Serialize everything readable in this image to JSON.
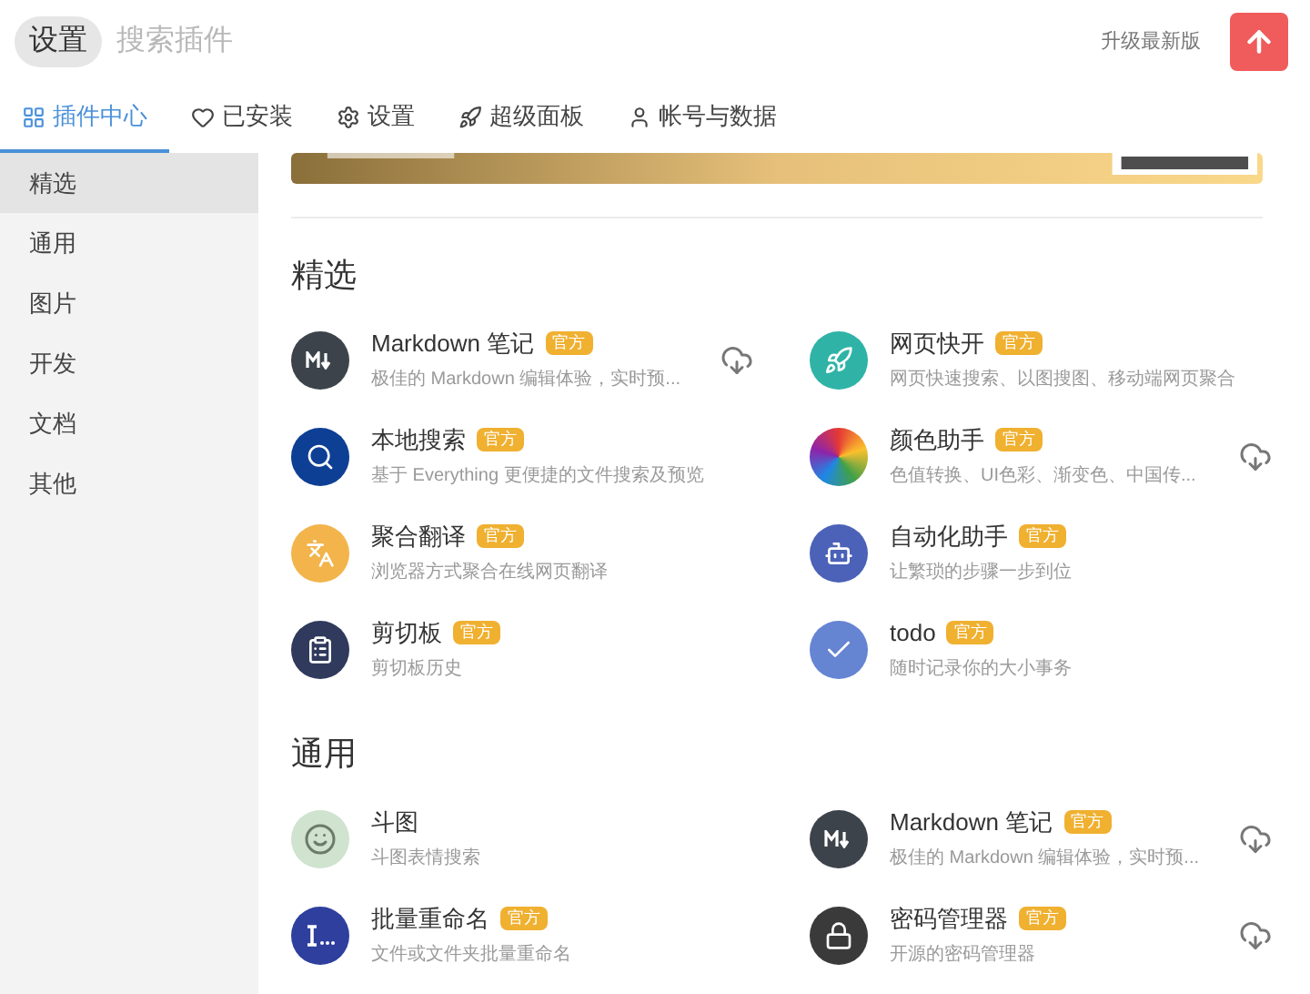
{
  "header": {
    "chip": "设置",
    "search": {
      "placeholder": "搜索插件"
    },
    "upgrade_label": "升级最新版"
  },
  "tabs": [
    {
      "label": "插件中心",
      "kind": "grid",
      "selected": true
    },
    {
      "label": "已安装",
      "kind": "heart",
      "selected": false
    },
    {
      "label": "设置",
      "kind": "gear",
      "selected": false
    },
    {
      "label": "超级面板",
      "kind": "rocket",
      "selected": false
    },
    {
      "label": "帐号与数据",
      "kind": "user",
      "selected": false
    }
  ],
  "sidebar": {
    "items": [
      {
        "label": "精选",
        "selected": true
      },
      {
        "label": "通用",
        "selected": false
      },
      {
        "label": "图片",
        "selected": false
      },
      {
        "label": "开发",
        "selected": false
      },
      {
        "label": "文档",
        "selected": false
      },
      {
        "label": "其他",
        "selected": false
      }
    ]
  },
  "sections": [
    {
      "title": "精选",
      "plugins": [
        {
          "name": "Markdown 笔记",
          "badge": "官方",
          "desc": "极佳的 Markdown 编辑体验，实时预...",
          "kind": "markdown",
          "color": "#3d434b",
          "download": true
        },
        {
          "name": "网页快开",
          "badge": "官方",
          "desc": "网页快速搜索、以图搜图、移动端网页聚合",
          "kind": "rocket",
          "color": "#2fb3a7",
          "download": false
        },
        {
          "name": "本地搜索",
          "badge": "官方",
          "desc": "基于 Everything 更便捷的文件搜索及预览",
          "kind": "search",
          "color": "#0d3f94",
          "download": false
        },
        {
          "name": "颜色助手",
          "badge": "官方",
          "desc": "色值转换、UI色彩、渐变色、中国传...",
          "kind": "color",
          "download": true
        },
        {
          "name": "聚合翻译",
          "badge": "官方",
          "desc": "浏览器方式聚合在线网页翻译",
          "kind": "translate",
          "color": "#f3b44b",
          "download": false
        },
        {
          "name": "自动化助手",
          "badge": "官方",
          "desc": "让繁琐的步骤一步到位",
          "kind": "robot",
          "color": "#4b62b8",
          "download": false
        },
        {
          "name": "剪切板",
          "badge": "官方",
          "desc": "剪切板历史",
          "kind": "clipboard",
          "color": "#2f3a5c",
          "download": false
        },
        {
          "name": "todo",
          "badge": "官方",
          "desc": "随时记录你的大小事务",
          "kind": "check",
          "color": "#6584d2",
          "download": false
        }
      ]
    },
    {
      "title": "通用",
      "plugins": [
        {
          "name": "斗图",
          "desc": "斗图表情搜索",
          "kind": "face",
          "color": "#cfe3cf",
          "download": false
        },
        {
          "name": "Markdown 笔记",
          "badge": "官方",
          "desc": "极佳的 Markdown 编辑体验，实时预...",
          "kind": "markdown",
          "color": "#3d434b",
          "download": true
        },
        {
          "name": "批量重命名",
          "badge": "官方",
          "desc": "文件或文件夹批量重命名",
          "kind": "rename",
          "color": "#2e3f9e",
          "download": false
        },
        {
          "name": "密码管理器",
          "badge": "官方",
          "desc": "开源的密码管理器",
          "kind": "lock",
          "color": "#3a3a3a",
          "download": true
        }
      ]
    }
  ]
}
